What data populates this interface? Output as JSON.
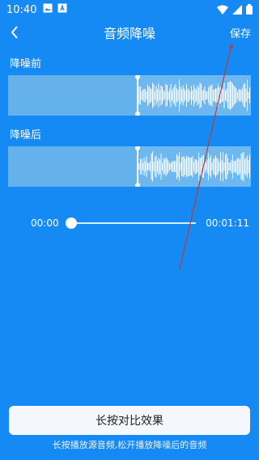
{
  "status": {
    "time": "10:40"
  },
  "appbar": {
    "title": "音频降噪",
    "save": "保存"
  },
  "sections": {
    "before": {
      "label": "降噪前"
    },
    "after": {
      "label": "降噪后"
    }
  },
  "player": {
    "current": "00:00",
    "duration": "00:01:11"
  },
  "actions": {
    "compare": "长按对比效果"
  },
  "hint": "长按播放源音频,松开播放降噪后的音频"
}
